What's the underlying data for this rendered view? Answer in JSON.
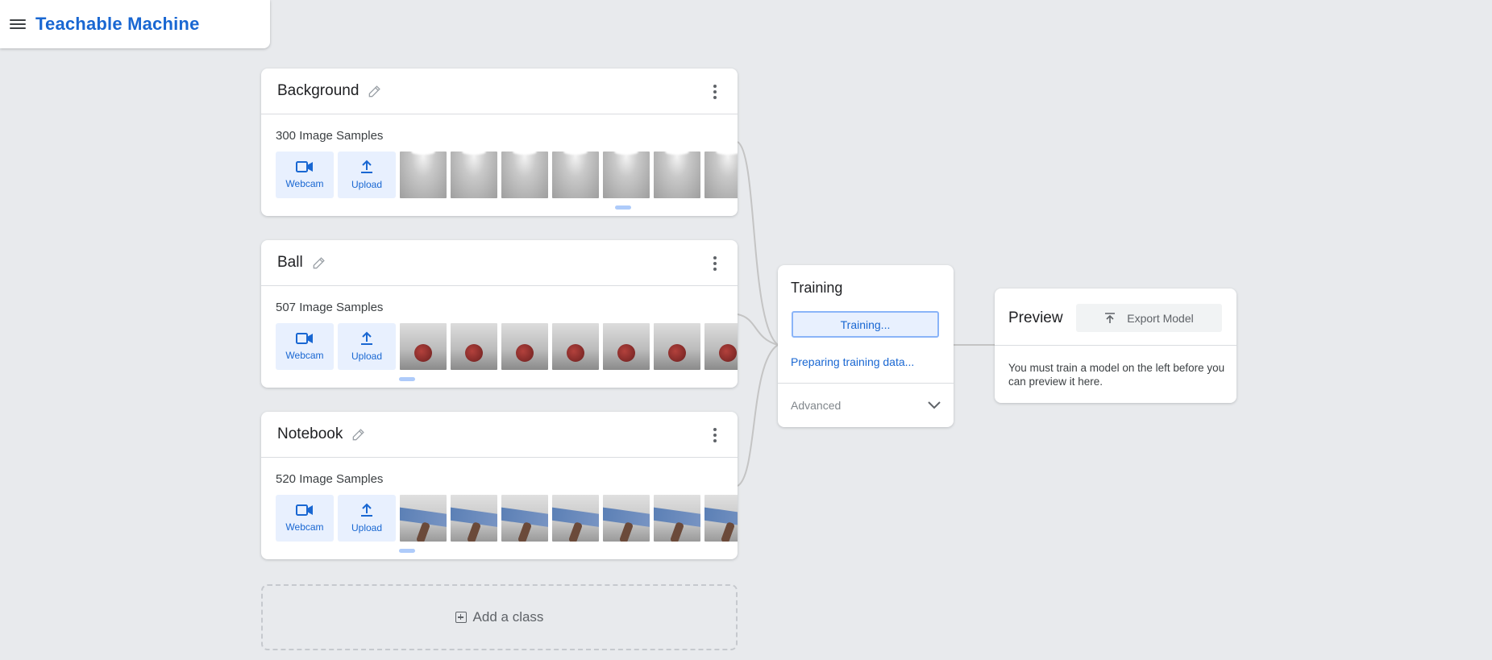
{
  "header": {
    "title": "Teachable Machine"
  },
  "classes": [
    {
      "name": "Background",
      "samples": "300 Image Samples",
      "webcam_label": "Webcam",
      "upload_label": "Upload",
      "thumb_type": "bg"
    },
    {
      "name": "Ball",
      "samples": "507 Image Samples",
      "webcam_label": "Webcam",
      "upload_label": "Upload",
      "thumb_type": "ball"
    },
    {
      "name": "Notebook",
      "samples": "520 Image Samples",
      "webcam_label": "Webcam",
      "upload_label": "Upload",
      "thumb_type": "note"
    }
  ],
  "add_class": {
    "label": "Add a class"
  },
  "training": {
    "title": "Training",
    "button_label": "Training...",
    "status": "Preparing training data...",
    "advanced_label": "Advanced"
  },
  "preview": {
    "title": "Preview",
    "export_label": "Export Model",
    "message": "You must train a model on the left before you can preview it here."
  },
  "colors": {
    "accent": "#1967d2",
    "accent_light": "#e8f0fe",
    "background": "#e8eaed"
  }
}
